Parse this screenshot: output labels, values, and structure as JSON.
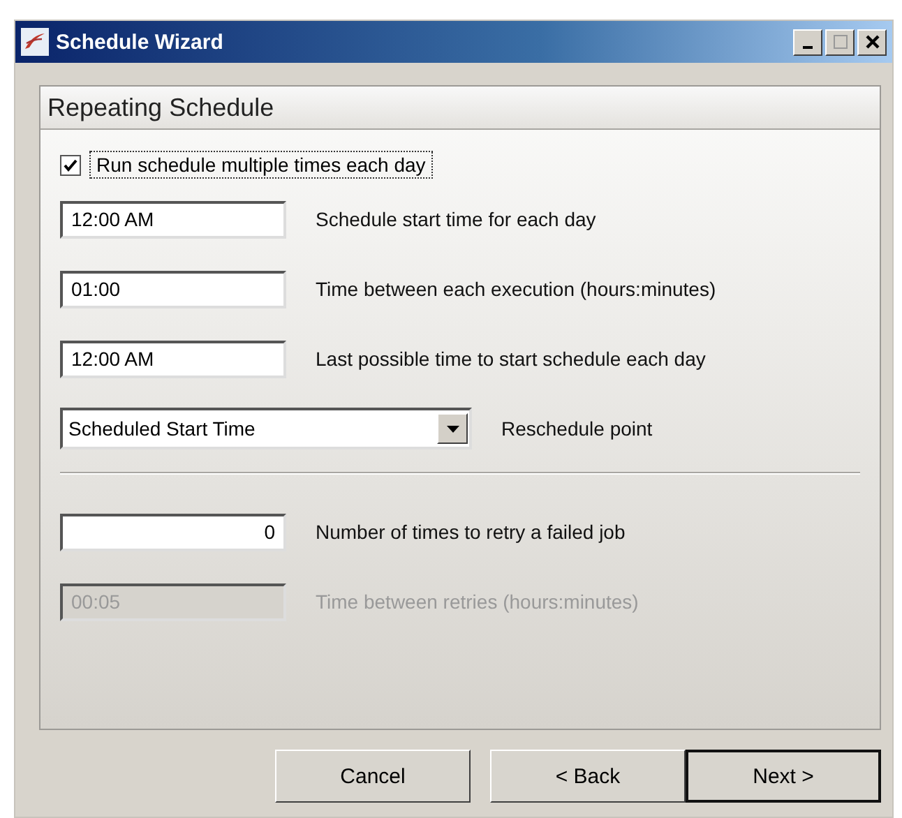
{
  "window": {
    "title": "Schedule Wizard"
  },
  "section": {
    "title": "Repeating Schedule"
  },
  "checkbox": {
    "label": "Run schedule multiple times each day",
    "checked": true
  },
  "fields": [
    {
      "kind": "text",
      "value": "12:00 AM",
      "label": "Schedule start time for each day",
      "disabled": false
    },
    {
      "kind": "text",
      "value": "01:00",
      "label": "Time between each execution (hours:minutes)",
      "disabled": false
    },
    {
      "kind": "text",
      "value": "12:00 AM",
      "label": "Last possible time to start schedule each day",
      "disabled": false
    },
    {
      "kind": "dropdown",
      "value": "Scheduled Start Time",
      "label": "Reschedule point",
      "disabled": false
    },
    {
      "kind": "divider"
    },
    {
      "kind": "number",
      "value": "0",
      "label": "Number of times to retry a failed job",
      "disabled": false
    },
    {
      "kind": "text",
      "value": "00:05",
      "label": "Time between retries (hours:minutes)",
      "disabled": true
    }
  ],
  "buttons": [
    {
      "label": "Cancel",
      "default": false
    },
    {
      "label": "< Back",
      "default": false
    },
    {
      "label": "Next >",
      "default": true
    }
  ]
}
